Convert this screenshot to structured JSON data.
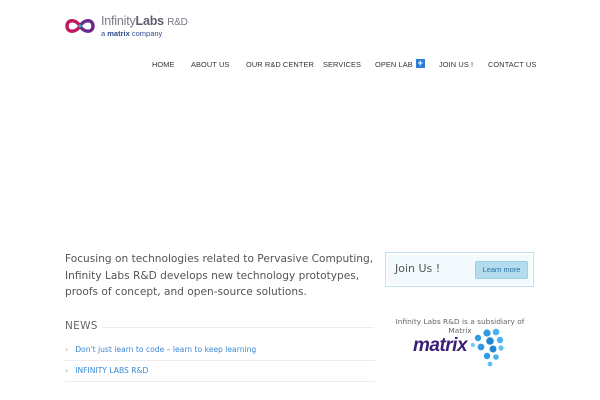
{
  "brand": {
    "name_light": "Infinity",
    "name_bold": "Labs",
    "name_suffix": "R&D",
    "tagline_prefix": "a",
    "tagline_bold": "matrix",
    "tagline_suffix": "company",
    "colors": {
      "magenta": "#c2185b",
      "purple": "#6b2a8a",
      "blue": "#2e4c8a",
      "teal": "#2bb3c6"
    }
  },
  "nav": {
    "items": [
      {
        "label": "HOME"
      },
      {
        "label": "ABOUT US"
      },
      {
        "label": "OUR R&D CENTER"
      },
      {
        "label": "SERVICES"
      },
      {
        "label": "OPEN LAB",
        "badge": "+"
      },
      {
        "label": "JOIN US !"
      },
      {
        "label": "CONTACT US"
      }
    ]
  },
  "intro": {
    "text": "Focusing on technologies related to Pervasive Computing, Infinity Labs R&D develops new technology prototypes, proofs of concept, and open-source solutions."
  },
  "news": {
    "title": "NEWS",
    "items": [
      {
        "label": "Don't just learn to code – learn to keep learning"
      },
      {
        "label": "INFINITY LABS R&D"
      }
    ]
  },
  "join": {
    "label": "Join Us !",
    "button": "Learn more"
  },
  "sidebar": {
    "subsidiary_text": "Infinity Labs R&D is a subsidiary of Matrix",
    "matrix_logo_text": "matrix",
    "matrix_colors": {
      "text": "#3a1f75",
      "dots": "#2f9be0"
    }
  }
}
